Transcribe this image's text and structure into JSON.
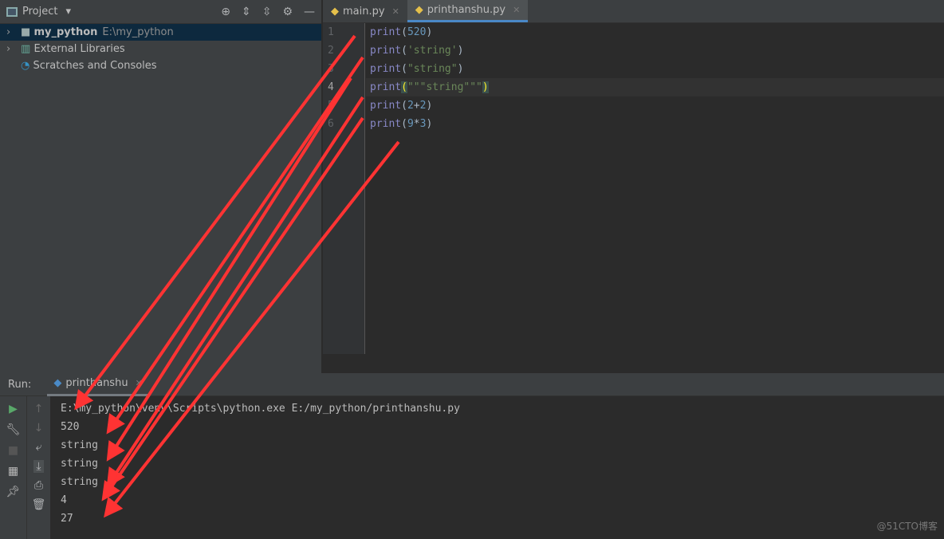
{
  "project": {
    "title": "Project",
    "tree": [
      {
        "label": "my_python",
        "path": "E:\\my_python"
      },
      {
        "label": "External Libraries"
      },
      {
        "label": "Scratches and Consoles"
      }
    ]
  },
  "editor": {
    "tabs": [
      {
        "label": "main.py"
      },
      {
        "label": "printhanshu.py",
        "active": true
      }
    ],
    "line_numbers": [
      "1",
      "2",
      "3",
      "4",
      "5",
      "6"
    ]
  },
  "run": {
    "label": "Run:",
    "tab": "printhanshu",
    "output": [
      "E:\\my_python\\venv\\Scripts\\python.exe E:/my_python/printhanshu.py",
      "520",
      "string",
      "string",
      "string",
      "4",
      "27"
    ]
  },
  "annotation_color": "#ff3333",
  "watermark": "@51CTO博客"
}
